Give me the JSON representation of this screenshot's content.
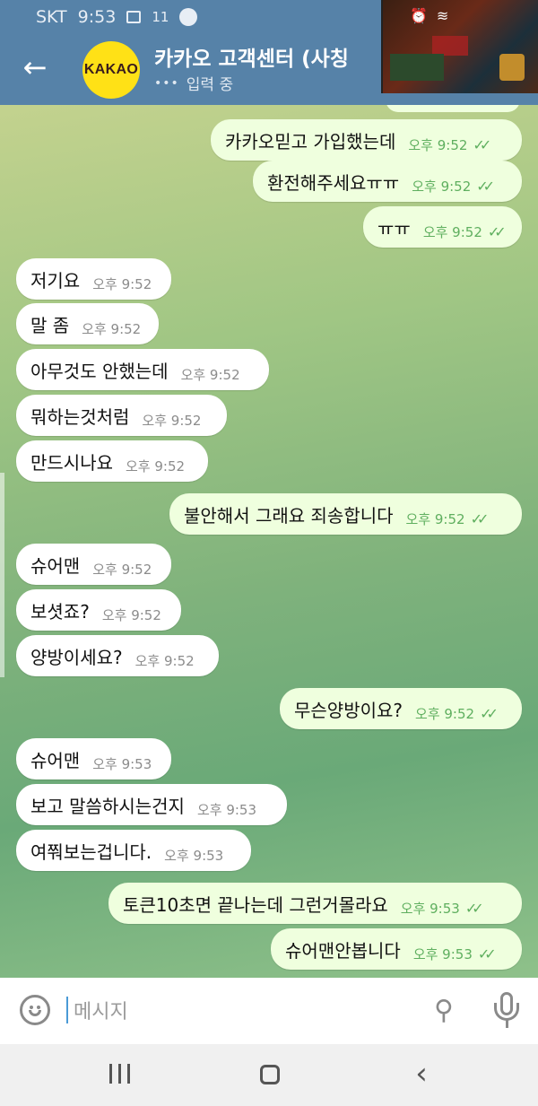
{
  "status_bar": {
    "carrier": "SKT",
    "time": "9:53",
    "count": "11"
  },
  "header": {
    "avatar_text": "KAKAO",
    "title": "카카오 고객센터 (사칭",
    "subtitle_dots": "•••",
    "subtitle": "입력 중"
  },
  "messages": [
    {
      "dir": "out",
      "text": "카카오믿고 가입했는데",
      "time": "오후 9:52",
      "read": "✓✓"
    },
    {
      "dir": "out",
      "text": "환전해주세요ㅠㅠ",
      "time": "오후 9:52",
      "read": "✓✓"
    },
    {
      "dir": "out",
      "text": "ㅠㅠ",
      "time": "오후 9:52",
      "read": "✓✓"
    },
    {
      "dir": "in",
      "text": "저기요",
      "time": "오후 9:52"
    },
    {
      "dir": "in",
      "text": "말 좀",
      "time": "오후 9:52"
    },
    {
      "dir": "in",
      "text": "아무것도 안했는데",
      "time": "오후 9:52"
    },
    {
      "dir": "in",
      "text": "뭐하는것처럼",
      "time": "오후 9:52"
    },
    {
      "dir": "in",
      "text": "만드시나요",
      "time": "오후 9:52"
    },
    {
      "dir": "out",
      "text": "불안해서 그래요 죄송합니다",
      "time": "오후 9:52",
      "read": "✓✓"
    },
    {
      "dir": "in",
      "text": "슈어맨",
      "time": "오후 9:52"
    },
    {
      "dir": "in",
      "text": "보셧죠?",
      "time": "오후 9:52"
    },
    {
      "dir": "in",
      "text": "양방이세요?",
      "time": "오후 9:52"
    },
    {
      "dir": "out",
      "text": "무슨양방이요?",
      "time": "오후 9:52",
      "read": "✓✓"
    },
    {
      "dir": "in",
      "text": "슈어맨",
      "time": "오후 9:53"
    },
    {
      "dir": "in",
      "text": "보고 말씀하시는건지",
      "time": "오후 9:53"
    },
    {
      "dir": "in",
      "text": "여쭤보는겁니다.",
      "time": "오후 9:53"
    },
    {
      "dir": "out",
      "text": "토큰10초면 끝나는데 그런거몰라요",
      "time": "오후 9:53",
      "read": "✓✓"
    },
    {
      "dir": "out",
      "text": "슈어맨안봅니다",
      "time": "오후 9:53",
      "read": "✓✓"
    }
  ],
  "composer": {
    "placeholder": "메시지"
  }
}
